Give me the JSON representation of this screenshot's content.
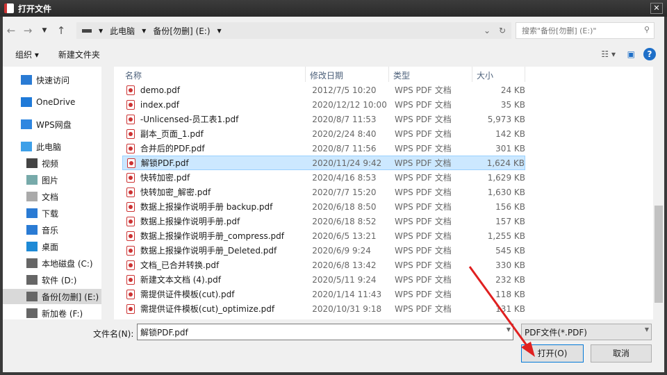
{
  "title": "打开文件",
  "nav": {
    "crumbs": [
      "此电脑",
      "备份[勿删] (E:)"
    ],
    "search_placeholder": "搜索\"备份[勿删] (E:)\""
  },
  "toolbar": {
    "organize": "组织 ▾",
    "new_folder": "新建文件夹",
    "help": "?"
  },
  "sidebar": [
    {
      "label": "快速访问",
      "color": "#2a7bd4"
    },
    {
      "label": "OneDrive",
      "color": "#1f7ad8"
    },
    {
      "label": "WPS网盘",
      "color": "#2f86e0"
    },
    {
      "label": "此电脑",
      "color": "#3ea0e8"
    },
    {
      "label": "视频",
      "color": "#444"
    },
    {
      "label": "图片",
      "color": "#7aa"
    },
    {
      "label": "文档",
      "color": "#aaa"
    },
    {
      "label": "下载",
      "color": "#2a7bd4"
    },
    {
      "label": "音乐",
      "color": "#2a7bd4"
    },
    {
      "label": "桌面",
      "color": "#1e8ad6"
    },
    {
      "label": "本地磁盘 (C:)",
      "color": "#666"
    },
    {
      "label": "软件 (D:)",
      "color": "#666"
    },
    {
      "label": "备份[勿删] (E:)",
      "color": "#666"
    },
    {
      "label": "新加卷 (F:)",
      "color": "#666"
    }
  ],
  "columns": [
    "名称",
    "修改日期",
    "类型",
    "大小"
  ],
  "files": [
    [
      "demo.pdf",
      "2012/7/5 10:20",
      "WPS PDF 文档",
      "24 KB"
    ],
    [
      "index.pdf",
      "2020/12/12 10:00",
      "WPS PDF 文档",
      "35 KB"
    ],
    [
      "-Unlicensed-员工表1.pdf",
      "2020/8/7 11:53",
      "WPS PDF 文档",
      "5,973 KB"
    ],
    [
      "副本_页面_1.pdf",
      "2020/2/24 8:40",
      "WPS PDF 文档",
      "142 KB"
    ],
    [
      "合并后的PDF.pdf",
      "2020/8/7 11:56",
      "WPS PDF 文档",
      "301 KB"
    ],
    [
      "解锁PDF.pdf",
      "2020/11/24 9:42",
      "WPS PDF 文档",
      "1,624 KB"
    ],
    [
      "快转加密.pdf",
      "2020/4/16 8:53",
      "WPS PDF 文档",
      "1,629 KB"
    ],
    [
      "快转加密_解密.pdf",
      "2020/7/7 15:20",
      "WPS PDF 文档",
      "1,630 KB"
    ],
    [
      "数据上报操作说明手册 backup.pdf",
      "2020/6/18 8:50",
      "WPS PDF 文档",
      "156 KB"
    ],
    [
      "数据上报操作说明手册.pdf",
      "2020/6/18 8:52",
      "WPS PDF 文档",
      "157 KB"
    ],
    [
      "数据上报操作说明手册_compress.pdf",
      "2020/6/5 13:21",
      "WPS PDF 文档",
      "1,255 KB"
    ],
    [
      "数据上报操作说明手册_Deleted.pdf",
      "2020/6/9 9:24",
      "WPS PDF 文档",
      "545 KB"
    ],
    [
      "文档_已合并转换.pdf",
      "2020/6/8 13:42",
      "WPS PDF 文档",
      "330 KB"
    ],
    [
      "新建文本文档 (4).pdf",
      "2020/5/11 9:24",
      "WPS PDF 文档",
      "232 KB"
    ],
    [
      "需提供证件模板(cut).pdf",
      "2020/1/14 11:43",
      "WPS PDF 文档",
      "118 KB"
    ],
    [
      "需提供证件模板(cut)_optimize.pdf",
      "2020/10/31 9:18",
      "WPS PDF 文档",
      "131 KB"
    ]
  ],
  "selected_index": 5,
  "bottom": {
    "filename_label": "文件名(N):",
    "filename_value": "解锁PDF.pdf",
    "filter": "PDF文件(*.PDF)",
    "open": "打开(O)",
    "cancel": "取消"
  }
}
